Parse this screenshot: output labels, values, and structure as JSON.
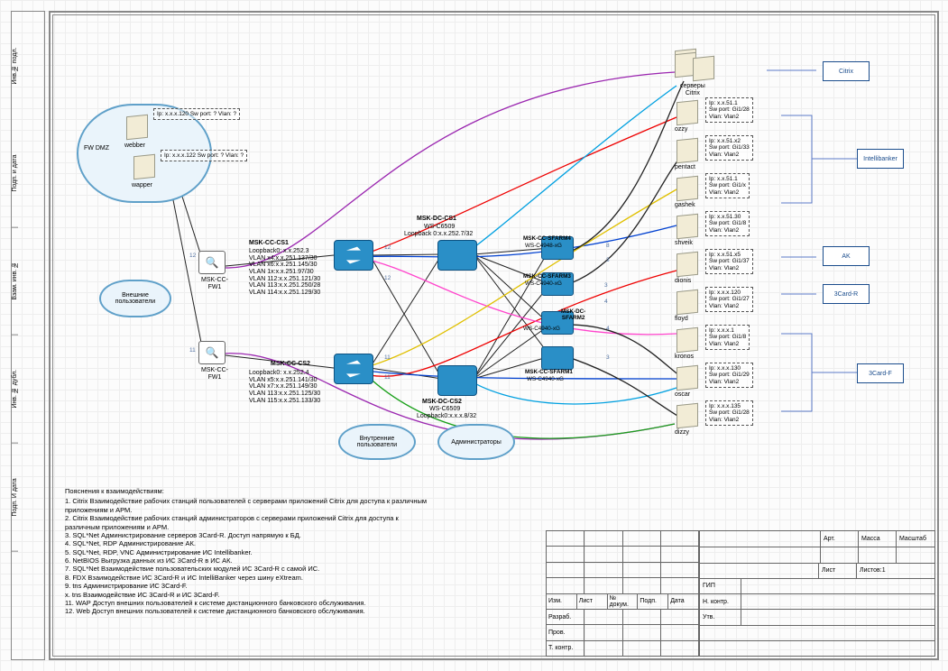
{
  "rail": [
    "Инв.№ подл.",
    "Подп. и дата",
    "Взам. инв. №",
    "Инв. № дубл.",
    "Подп. И дата",
    ""
  ],
  "clouds": {
    "dmz": "FW DMZ",
    "ext_users": "Внешние\nпользователи",
    "int_users": "Внутренние\nпользователи",
    "admins": "Администраторы"
  },
  "fw": {
    "fw1a": "MSK-CC-\nFW1",
    "fw1b": "MSK-CC-\nFW1"
  },
  "webber": {
    "name": "webber",
    "info": "Ip: x.x.x.120\nSw port: ?\nVlan: ?"
  },
  "wapper": {
    "name": "wapper",
    "info": "Ip: x.x.x.122\nSw port: ?\nVlan: ?"
  },
  "cs1": {
    "name": "MSK-CC-CS1",
    "cfg": "Loopback0: x.x.252.3\nVLAN x4:x.x.251.137/30\nVLAN x6:x.x.251.145/30\nVLAN 1x:x.x.251.97/30\nVLAN 112:x.x.251.121/30\nVLAN 113:x.x.251.250/28\nVLAN 114:x.x.251.129/30"
  },
  "cs2": {
    "name": "MSK-CC-CS2",
    "cfg": "Loopback0: x.x.252.4\nVLAN x5:x.x.251.141/30\nVLAN x7:x.x.251.149/30\nVLAN 113:x.x.251.125/30\nVLAN 115:x.x.251.133/30"
  },
  "dc1": {
    "name": "MSK-DC-CS1",
    "model": "WS-C6509",
    "cfg": "Loopback 0:x.x.252.7/32"
  },
  "dc2": {
    "name": "MSK-DC-CS2",
    "model": "WS-C6509",
    "cfg": "Loopback0:x.x.x.8/32"
  },
  "sfarm4": {
    "name": "MSK-CC-SFARM4",
    "model": "WS-C4948-xG"
  },
  "sfarm3": {
    "name": "MSK-CC-SFARM3",
    "model": "WS-C4940-xG"
  },
  "sfarm2": {
    "name": "MSK-DC-\nSFARM2",
    "model": "WS-C4940-xG"
  },
  "sfarm1": {
    "name": "MSK-CC-SFARM1",
    "model": "WS-C4940-xG"
  },
  "citrix": {
    "label": "серверы\nCitrix"
  },
  "servers": [
    {
      "name": "ozzy",
      "info": "Ip: x.x.51.1\nSw port: Gi1/28\nVlan: Vlan2"
    },
    {
      "name": "pentact",
      "info": "Ip: x.x.51.x2\nSw port: Gi1/33\nVlan: Vlan2"
    },
    {
      "name": "gashek",
      "info": "Ip: x.x.51.1\nSw port: Gi1/x\nVlan: Vlan2"
    },
    {
      "name": "shveik",
      "info": "Ip: x.x.51.30\nSw port: Gi1/8\nVlan: Vlan2"
    },
    {
      "name": "dionis",
      "info": "Ip: x.x.51.x5\nSw port: Gi1/37\nVlan: Vlan2"
    },
    {
      "name": "floyd",
      "info": "Ip: x.x.x.120\nSw port: Gi1/27\nVlan: Vlan2"
    },
    {
      "name": "kronos",
      "info": "Ip: x.x.x.1\nSw port: Gi1/8\nVlan: Vlan2"
    },
    {
      "name": "oscar",
      "info": "Ip: x.x.x.130\nSw port: Gi1/29\nVlan: Vlan2"
    },
    {
      "name": "dizzy",
      "info": "Ip: x.x.x.135\nSw port: Gi1/28\nVlan: Vlan2"
    }
  ],
  "apps": [
    "Citrix",
    "Intellibanker",
    "AK",
    "3Card-R",
    "3Card-F"
  ],
  "notes": {
    "title": "Пояснения к взаимодействиям:",
    "lines": [
      "1. Citrix Взаимодействие рабочих станций пользователей с серверами приложений Citrix для доступа к различным",
      "приложениям и АРМ.",
      "2. Citrix Взаимодействие рабочих станций администраторов с серверами приложений Citrix для доступа к",
      "различным приложениям и АРМ.",
      "3. SQL*Net Администрирование серверов 3Card-R. Доступ напрямую к БД.",
      "4. SQL*Net, RDP Администрирование АК.",
      "5. SQL*Net, RDP, VNC Администрирование ИС Intellibanker.",
      "6. NetBIOS Выгрузка данных из ИС 3Card-R в ИС АК.",
      "7. SQL*Net Взаимодействие пользовательских модулей ИС 3Card-R с самой ИС.",
      "8. FDX Взаимодействие ИС 3Card-R и ИС IntelliBanker через шину eXtream.",
      "9. tns Администрирование ИС 3Card-F.",
      "x. tns Взаимодействие ИС 3Card-R и ИС 3Card-F.",
      "11. WAP Доступ внешних пользователей к системе дистанционного банковского обслуживания.",
      "12. Web Доступ внешних пользователей к системе дистанционного банковского обслуживания."
    ]
  },
  "tblock": {
    "headers": [
      "Изм.",
      "Лист",
      "№ докум.",
      "Подп.",
      "Дата"
    ],
    "rows": [
      "Разраб.",
      "Пров.",
      "Т. контр.",
      "ГИП",
      "Н. контр.",
      "Утв."
    ],
    "right": {
      "art": "Арт.",
      "mass": "Масса",
      "scale": "Масштаб",
      "sheet": "Лист",
      "sheets": "Листов:1"
    }
  }
}
